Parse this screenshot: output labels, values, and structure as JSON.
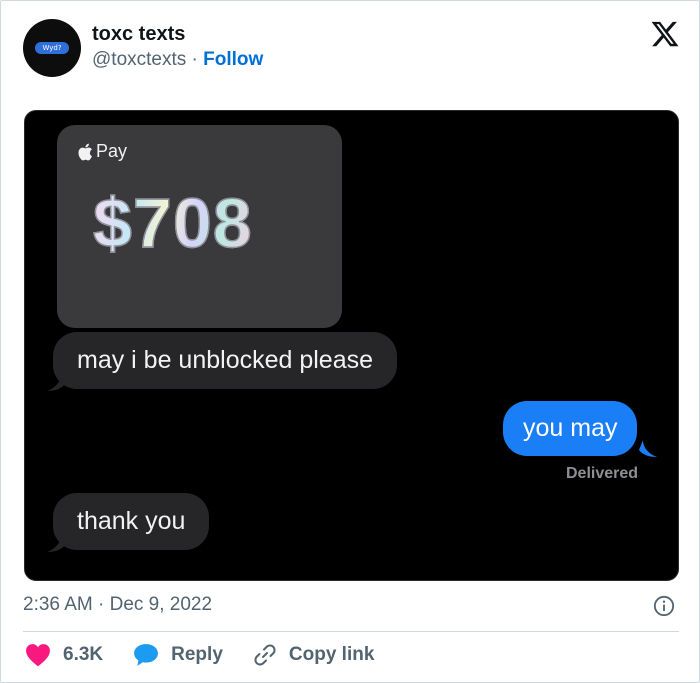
{
  "tweet": {
    "author_name": "toxc texts",
    "author_handle": "@toxctexts",
    "separator": "·",
    "follow_label": "Follow",
    "avatar_text": "Wyd?",
    "timestamp": "2:36 AM · Dec 9, 2022"
  },
  "media": {
    "pay_label": "Pay",
    "pay_amount": "$708",
    "message_1": "may i be unblocked please",
    "message_2": "you may",
    "delivered_label": "Delivered",
    "message_3": "thank you"
  },
  "actions": {
    "like_count": "6.3K",
    "reply_label": "Reply",
    "copy_label": "Copy link"
  },
  "colors": {
    "like": "#f91880",
    "reply": "#1d9bf0",
    "link": "#006fd6",
    "imessage_blue": "#1a7ff6"
  },
  "icons": [
    "x-logo-icon",
    "apple-icon",
    "info-icon",
    "heart-icon",
    "reply-bubble-icon",
    "link-icon"
  ]
}
